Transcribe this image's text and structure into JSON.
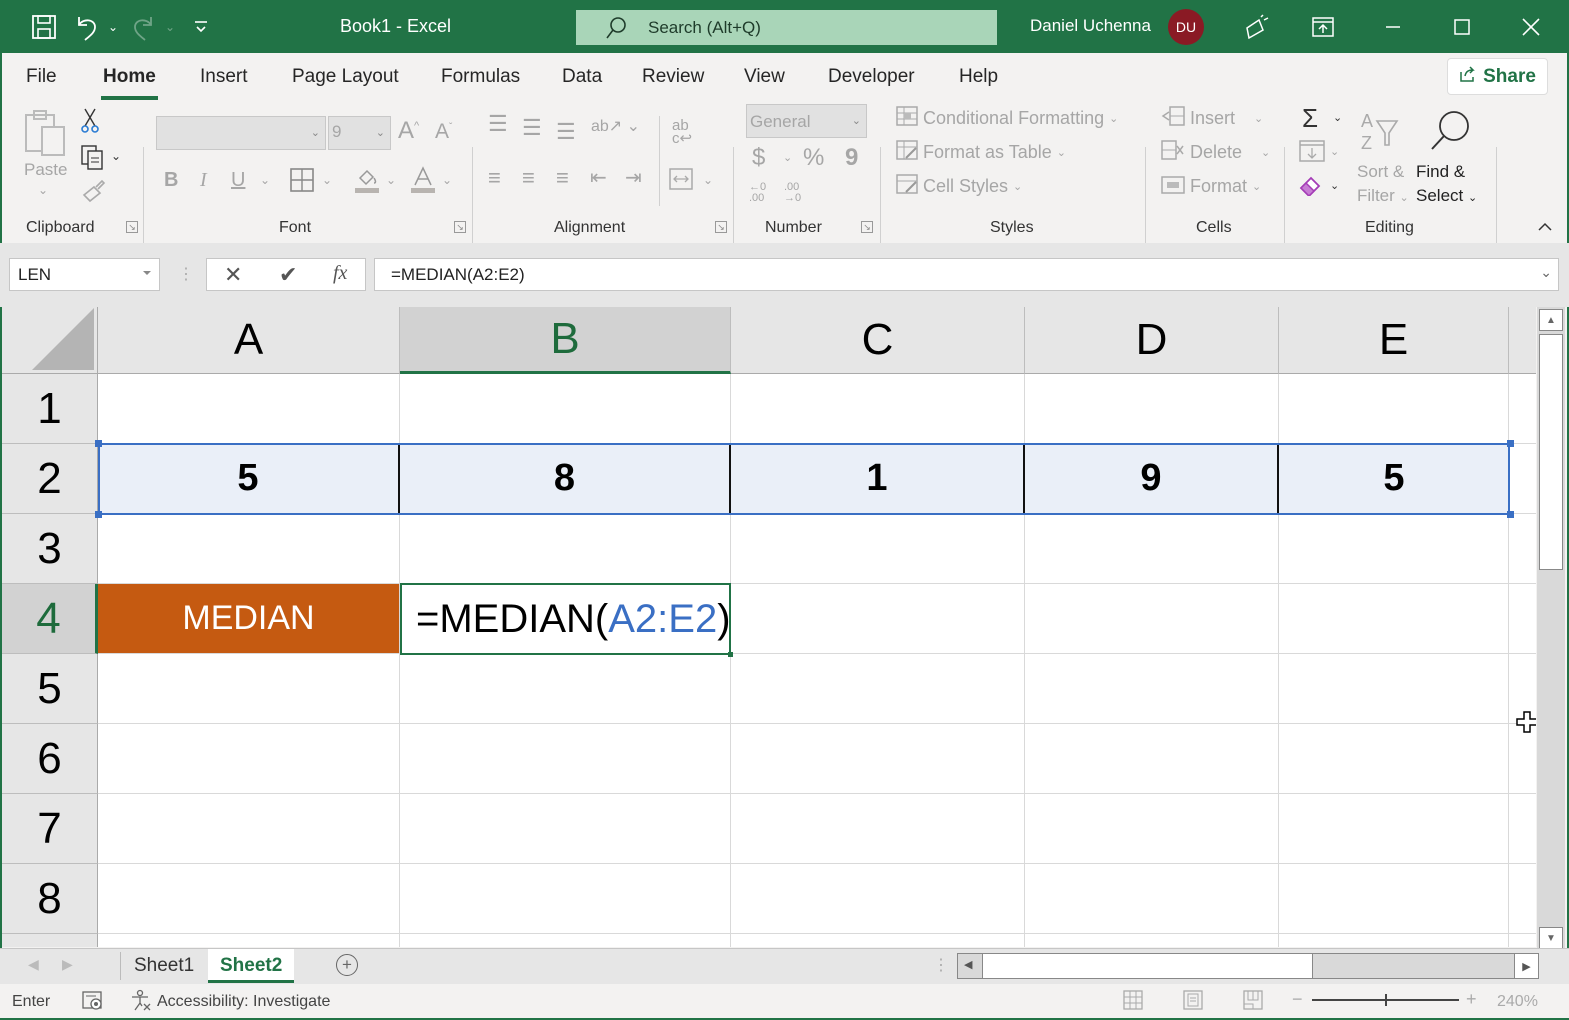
{
  "titlebar": {
    "title": "Book1  -  Excel",
    "search_placeholder": "Search (Alt+Q)",
    "user_name": "Daniel Uchenna",
    "user_initials": "DU",
    "icons": [
      "save-icon",
      "undo-icon",
      "redo-icon",
      "customize-qat-icon",
      "search-icon",
      "coauthoring-icon",
      "ribbon-display-icon",
      "minimize-icon",
      "maximize-icon",
      "close-icon"
    ]
  },
  "menu": {
    "tabs": [
      "File",
      "Home",
      "Insert",
      "Page Layout",
      "Formulas",
      "Data",
      "Review",
      "View",
      "Developer",
      "Help"
    ],
    "active_tab": "Home",
    "share_label": "Share"
  },
  "ribbon": {
    "clipboard": {
      "label": "Clipboard",
      "paste_label": "Paste"
    },
    "font": {
      "label": "Font",
      "font_name": "",
      "font_size": "9",
      "bold": "B",
      "italic": "I",
      "underline": "U"
    },
    "alignment": {
      "label": "Alignment"
    },
    "number": {
      "label": "Number",
      "format": "General",
      "currency": "$",
      "percent": "%",
      "comma": "9",
      "inc_decimal": "←.0 .00",
      "dec_decimal": ".00 →.0"
    },
    "styles": {
      "label": "Styles",
      "conditional_formatting": "Conditional Formatting",
      "format_as_table": "Format as Table",
      "cell_styles": "Cell Styles"
    },
    "cells": {
      "label": "Cells",
      "insert": "Insert",
      "delete": "Delete",
      "format": "Format"
    },
    "editing": {
      "label": "Editing",
      "autosum": "Σ",
      "sort_filter_1": "Sort &",
      "sort_filter_2": "Filter",
      "find_select_1": "Find &",
      "find_select_2": "Select"
    }
  },
  "formula_bar": {
    "name_box": "LEN",
    "cancel": "✕",
    "enter": "✔",
    "fx": "fx",
    "formula": "=MEDIAN(A2:E2)"
  },
  "grid": {
    "columns": [
      "A",
      "B",
      "C",
      "D",
      "E"
    ],
    "selected_column": "B",
    "rows": [
      "1",
      "2",
      "3",
      "4",
      "5",
      "6",
      "7",
      "8"
    ],
    "selected_row": "4",
    "row2_values": [
      "5",
      "8",
      "1",
      "9",
      "5"
    ],
    "a4_label": "MEDIAN",
    "b4_formula_prefix": "=MEDIAN(",
    "b4_formula_ref": "A2:E2",
    "b4_formula_suffix": ")",
    "label_color": "#c55a11",
    "ref_color": "#3a6fc4"
  },
  "sheets": {
    "tabs": [
      "Sheet1",
      "Sheet2"
    ],
    "active": "Sheet2"
  },
  "statusbar": {
    "mode": "Enter",
    "accessibility": "Accessibility: Investigate",
    "zoom": "240%",
    "zoom_minus": "−",
    "zoom_plus": "+"
  }
}
